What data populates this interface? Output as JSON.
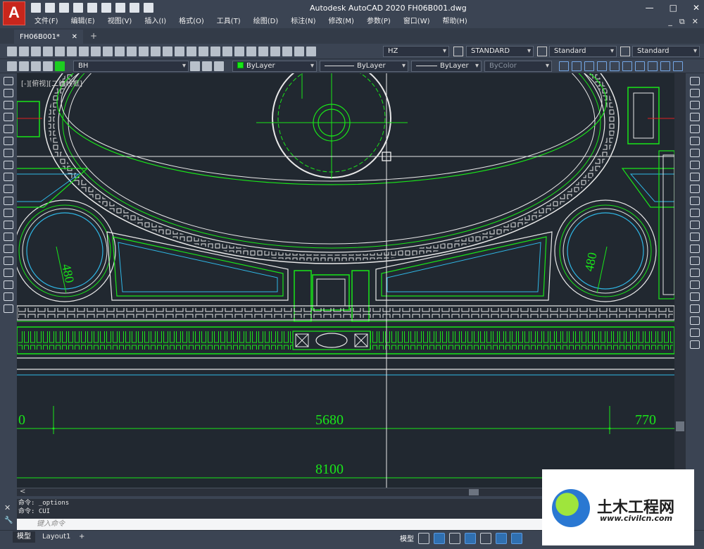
{
  "app": {
    "logo_letter": "A",
    "title": "Autodesk AutoCAD 2020    FH06B001.dwg"
  },
  "window_controls": {
    "minimize": "—",
    "maximize": "□",
    "close": "✕",
    "doc_min": "_",
    "doc_restore": "⧉",
    "doc_close": "✕"
  },
  "menu": [
    "文件(F)",
    "编辑(E)",
    "视图(V)",
    "插入(I)",
    "格式(O)",
    "工具(T)",
    "绘图(D)",
    "标注(N)",
    "修改(M)",
    "参数(P)",
    "窗口(W)",
    "帮助(H)"
  ],
  "doc_tab": {
    "label": "FH06B001*",
    "close": "✕",
    "new": "+"
  },
  "toolbar1": {
    "text_style": "HZ",
    "dim_style": "STANDARD",
    "table_style": "Standard",
    "mleader_style": "Standard"
  },
  "toolbar2": {
    "layer": "BH",
    "color": "ByLayer",
    "linetype": "ByLayer",
    "lineweight": "ByLayer",
    "plotstyle": "ByColor"
  },
  "canvas": {
    "viewport_label": "[-][俯视][二维线框]",
    "dimensions": {
      "left_partial": "0",
      "main": "5680",
      "right": "770",
      "total": "8100",
      "radius_left": "480",
      "radius_right": "480"
    }
  },
  "command": {
    "history": [
      "命令: _options",
      "命令: CUI"
    ],
    "placeholder": "键入命令",
    "close_icon": "✕",
    "wrench_icon": "🔧"
  },
  "status": {
    "model_tab": "模型",
    "layout_tab": "Layout1",
    "add_tab": "+",
    "model_label": "模型"
  },
  "watermark": {
    "name": "土木工程网",
    "url": "www.civilcn.com"
  },
  "colors": {
    "canvas_bg": "#212830",
    "ui_bg": "#3b4453",
    "green_lines": "#19e619",
    "white_lines": "#e8e8e8",
    "cyan_lines": "#2fb7e6",
    "red_lines": "#e02020"
  }
}
